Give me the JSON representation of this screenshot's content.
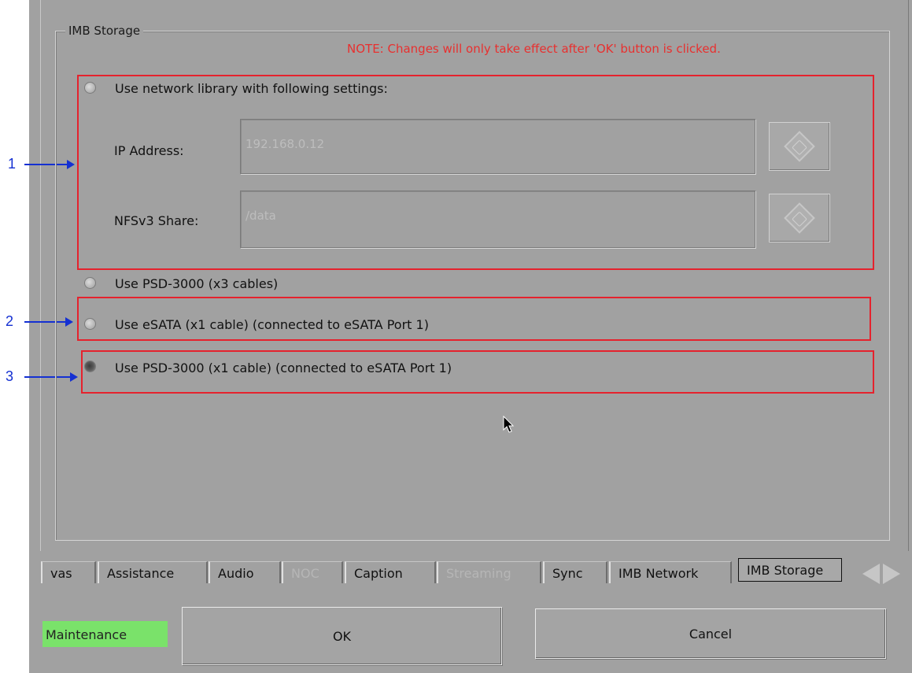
{
  "annotations": [
    "1",
    "2",
    "3"
  ],
  "groupbox": {
    "title": "IMB Storage",
    "note": "NOTE: Changes will only take effect after 'OK' button is clicked."
  },
  "options": {
    "network": "Use network library with following settings:",
    "psd_x3": "Use PSD-3000 (x3 cables)",
    "esata": "Use eSATA (x1 cable)   (connected to eSATA Port 1)",
    "psd_x1": "Use PSD-3000 (x1 cable)   (connected to eSATA Port 1)",
    "selected": "psd_x1"
  },
  "fields": {
    "ip_label": "IP Address:",
    "ip_value": "192.168.0.12",
    "nfs_label": "NFSv3 Share:",
    "nfs_value": "/data"
  },
  "tabs": [
    "vas",
    "Assistance",
    "Audio",
    "NOC",
    "Caption",
    "Streaming",
    "Sync",
    "IMB Network",
    "IMB Storage"
  ],
  "disabled_tabs": [
    "NOC",
    "Streaming"
  ],
  "active_tab": "IMB Storage",
  "status": {
    "label": "Maintenance",
    "color": "#7ae26a"
  },
  "buttons": {
    "ok": "OK",
    "cancel": "Cancel"
  },
  "icons": {
    "keyboard": "on-screen-keyboard-icon",
    "tab_prev": "triangle-left-icon",
    "tab_next": "triangle-right-icon",
    "cursor": "mouse-pointer-icon"
  },
  "colors": {
    "background": "#a1a1a1",
    "note": "#e8302f",
    "highlight_box": "#e5222d",
    "annotation": "#1430d2"
  }
}
